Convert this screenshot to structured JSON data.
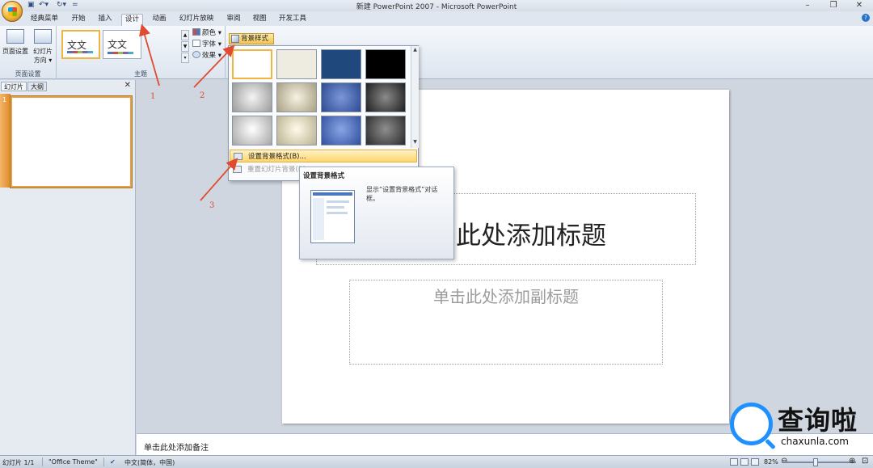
{
  "window": {
    "title": "新建 PowerPoint 2007 - Microsoft PowerPoint"
  },
  "qat": {
    "customize": "="
  },
  "tabs": [
    {
      "label": "经典菜单"
    },
    {
      "label": "开始"
    },
    {
      "label": "插入"
    },
    {
      "label": "设计"
    },
    {
      "label": "动画"
    },
    {
      "label": "幻灯片放映"
    },
    {
      "label": "审阅"
    },
    {
      "label": "视图"
    },
    {
      "label": "开发工具"
    }
  ],
  "ribbon": {
    "page_setup": {
      "btn1_label": "页面设置",
      "btn2_label": "幻灯片",
      "btn2_sub": "方向 ▾",
      "group_label": "页面设置"
    },
    "themes": {
      "theme1": "文文",
      "theme2": "文文",
      "group_label": "主题",
      "colors_label": "颜色 ▾",
      "fonts_label": "字体 ▾",
      "effects_label": "效果 ▾"
    },
    "background": {
      "bg_style_label": "背景样式 ▾"
    }
  },
  "left_pane": {
    "tab_slides": "幻灯片",
    "tab_outline": "大纲",
    "close": "✕",
    "slide_number": "1"
  },
  "slide": {
    "title_placeholder": "单击此处添加标题",
    "subtitle_placeholder": "单击此处添加副标题"
  },
  "notes": {
    "placeholder": "单击此处添加备注"
  },
  "status": {
    "slide_count": "幻灯片 1/1",
    "theme": "\"Office Theme\"",
    "language": "中文(简体，中国)",
    "zoom": "82%"
  },
  "dropdown": {
    "swatches": [
      {
        "color": "#ffffff"
      },
      {
        "color": "#eeece1"
      },
      {
        "color": "#1f497d"
      },
      {
        "color": "#000000"
      },
      {
        "color": "#c9c9c9"
      },
      {
        "color": "#d8d2bd"
      },
      {
        "color": "#3c5ca8"
      },
      {
        "color": "#3a3a3a"
      },
      {
        "color": "#dcdcdc"
      },
      {
        "color": "#ece5c8"
      },
      {
        "color": "#4a6cc0"
      },
      {
        "color": "#4d4d4d"
      }
    ],
    "format_bg": "设置背景格式(B)...",
    "reset_bg": "重置幻灯片背景(R)"
  },
  "tooltip": {
    "title": "设置背景格式",
    "body": "显示“设置背景格式”对话框。"
  },
  "annotations": {
    "n1": "1",
    "n2": "2",
    "n3": "3"
  },
  "watermark": {
    "name": "查询啦",
    "url": "chaxunla.com"
  }
}
